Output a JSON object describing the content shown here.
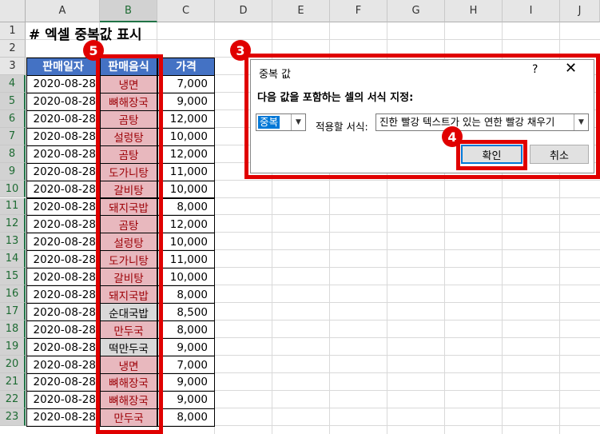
{
  "columns": [
    "A",
    "B",
    "C",
    "D",
    "E",
    "F",
    "G",
    "H",
    "I",
    "J"
  ],
  "rows": [
    "1",
    "2",
    "3",
    "4",
    "5",
    "6",
    "7",
    "8",
    "9",
    "10",
    "11",
    "12",
    "13",
    "14",
    "15",
    "16",
    "17",
    "18",
    "19",
    "20",
    "21",
    "22",
    "23"
  ],
  "title": "# 엑셀 중복값 표시",
  "table": {
    "headers": [
      "판매일자",
      "판매음식",
      "가격"
    ],
    "records": [
      {
        "date": "2020-08-28",
        "food": "냉면",
        "price": "7,000",
        "dup": true
      },
      {
        "date": "2020-08-28",
        "food": "뼈해장국",
        "price": "9,000",
        "dup": true
      },
      {
        "date": "2020-08-28",
        "food": "곰탕",
        "price": "12,000",
        "dup": true
      },
      {
        "date": "2020-08-28",
        "food": "설렁탕",
        "price": "10,000",
        "dup": true
      },
      {
        "date": "2020-08-28",
        "food": "곰탕",
        "price": "12,000",
        "dup": true
      },
      {
        "date": "2020-08-28",
        "food": "도가니탕",
        "price": "11,000",
        "dup": true
      },
      {
        "date": "2020-08-28",
        "food": "갈비탕",
        "price": "10,000",
        "dup": true
      },
      {
        "date": "2020-08-28",
        "food": "돼지국밥",
        "price": "8,000",
        "dup": true
      },
      {
        "date": "2020-08-28",
        "food": "곰탕",
        "price": "12,000",
        "dup": true
      },
      {
        "date": "2020-08-28",
        "food": "설렁탕",
        "price": "10,000",
        "dup": true
      },
      {
        "date": "2020-08-28",
        "food": "도가니탕",
        "price": "11,000",
        "dup": true
      },
      {
        "date": "2020-08-28",
        "food": "갈비탕",
        "price": "10,000",
        "dup": true
      },
      {
        "date": "2020-08-28",
        "food": "돼지국밥",
        "price": "8,000",
        "dup": true
      },
      {
        "date": "2020-08-28",
        "food": "순대국밥",
        "price": "8,500",
        "dup": false
      },
      {
        "date": "2020-08-28",
        "food": "만두국",
        "price": "8,000",
        "dup": true
      },
      {
        "date": "2020-08-28",
        "food": "떡만두국",
        "price": "9,000",
        "dup": false
      },
      {
        "date": "2020-08-28",
        "food": "냉면",
        "price": "7,000",
        "dup": true
      },
      {
        "date": "2020-08-28",
        "food": "뼈해장국",
        "price": "9,000",
        "dup": true
      },
      {
        "date": "2020-08-28",
        "food": "뼈해장국",
        "price": "9,000",
        "dup": true
      },
      {
        "date": "2020-08-28",
        "food": "만두국",
        "price": "8,000",
        "dup": true
      }
    ]
  },
  "dialog": {
    "title": "중복 값",
    "help": "?",
    "close": "✕",
    "prompt": "다음 값을 포함하는 셀의 서식 지정:",
    "rule_value": "중복",
    "format_label": "적용할 서식:",
    "format_value": "진한 빨강 텍스트가 있는 연한 빨강 채우기",
    "ok_label": "확인",
    "cancel_label": "취소"
  },
  "badges": [
    "3",
    "4",
    "5"
  ],
  "colors": {
    "header_fill": "#4472c4",
    "duplicate_fill": "#e8b8be",
    "duplicate_text": "#9c0006",
    "annotation_red": "#e00000"
  }
}
